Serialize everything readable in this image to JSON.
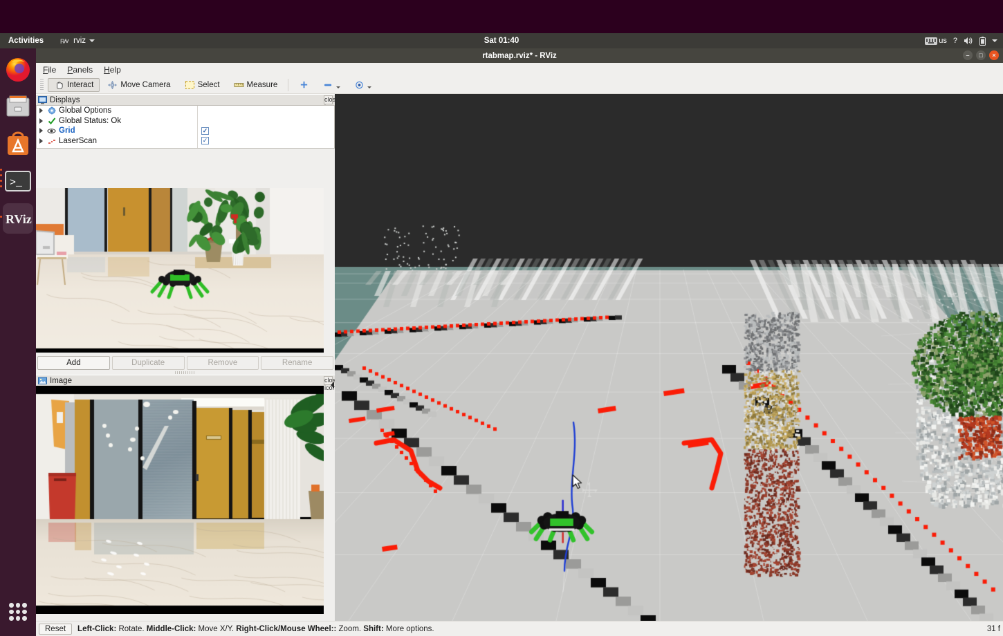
{
  "desktop": {
    "activities_label": "Activities",
    "app_menu_label": "rviz",
    "app_menu_icon": "rviz-icon",
    "clock": "Sat 01:40",
    "tray": {
      "keyboard_layout": "us",
      "help_icon": "?",
      "volume_icon": "speaker-icon",
      "battery_icon": "battery-icon",
      "menu_arrow_icon": "chevron-down-icon"
    },
    "dock_items": [
      {
        "name": "firefox",
        "label": "Firefox",
        "running": false
      },
      {
        "name": "files",
        "label": "Files",
        "running": false
      },
      {
        "name": "ubuntu-software",
        "label": "Ubuntu Software",
        "running": false
      },
      {
        "name": "terminal",
        "label": "Terminal",
        "running": true
      },
      {
        "name": "rviz",
        "label": "RViz",
        "running": true
      }
    ],
    "show_apps_label": "Show Applications"
  },
  "window": {
    "title": "rtabmap.rviz* - RViz",
    "controls": {
      "minimize": "–",
      "maximize": "□",
      "close": "×"
    }
  },
  "menubar": [
    {
      "name": "menu-file",
      "label": "File",
      "mnemonic": "F"
    },
    {
      "name": "menu-panels",
      "label": "Panels",
      "mnemonic": "P"
    },
    {
      "name": "menu-help",
      "label": "Help",
      "mnemonic": "H"
    }
  ],
  "toolbar": {
    "tools": [
      {
        "name": "tool-interact",
        "label": "Interact",
        "icon": "hand-cursor-icon",
        "active": true
      },
      {
        "name": "tool-move-camera",
        "label": "Move Camera",
        "icon": "move-camera-icon",
        "active": false
      },
      {
        "name": "tool-select",
        "label": "Select",
        "icon": "selection-box-icon",
        "active": false
      },
      {
        "name": "tool-measure",
        "label": "Measure",
        "icon": "ruler-icon",
        "active": false
      }
    ],
    "extra": [
      {
        "name": "tool-2d-pose-estimate",
        "icon": "plus-marker-icon",
        "label": ""
      },
      {
        "name": "tool-2d-nav-goal",
        "icon": "arrow-marker-icon",
        "label": "",
        "has_dropdown": true
      },
      {
        "name": "tool-publish-point",
        "icon": "focus-eye-icon",
        "label": "",
        "has_dropdown": true
      }
    ]
  },
  "displays_panel": {
    "title": "Displays",
    "title_icon": "display-monitor-icon",
    "close_icon": "close-icon",
    "tree": [
      {
        "name": "global-options",
        "label": "Global Options",
        "icon": "gear-icon",
        "checkbox": null,
        "expanded": false,
        "selected": false
      },
      {
        "name": "global-status",
        "label": "Global Status: Ok",
        "icon": "check-icon",
        "checkbox": null,
        "expanded": false,
        "selected": false
      },
      {
        "name": "grid",
        "label": "Grid",
        "icon": "grid-eye-icon",
        "checkbox": true,
        "expanded": false,
        "selected": true
      },
      {
        "name": "laserscan",
        "label": "LaserScan",
        "icon": "laserscan-icon",
        "checkbox": true,
        "expanded": false,
        "selected": false
      }
    ],
    "buttons": [
      {
        "name": "add-display-button",
        "label": "Add",
        "enabled": true
      },
      {
        "name": "duplicate-display-button",
        "label": "Duplicate",
        "enabled": false
      },
      {
        "name": "remove-display-button",
        "label": "Remove",
        "enabled": false
      },
      {
        "name": "rename-display-button",
        "label": "Rename",
        "enabled": false
      }
    ]
  },
  "image_panel": {
    "title": "Image",
    "title_icon": "image-icon",
    "close_icon": "close-icon"
  },
  "statusbar": {
    "reset_label": "Reset",
    "hint_parts": [
      {
        "bold": "Left-Click:",
        "text": " Rotate. "
      },
      {
        "bold": "Middle-Click:",
        "text": " Move X/Y. "
      },
      {
        "bold": "Right-Click/Mouse Wheel::",
        "text": " Zoom. "
      },
      {
        "bold": "Shift:",
        "text": " More options."
      }
    ],
    "fps": "31 f"
  },
  "viewport": {
    "background_color": "#2b2b2b",
    "ground_color": "#6b8c87",
    "floor_color": "#c9c9c7",
    "laserscan_color": "#fb1c06",
    "path_color": "#1f3fd4",
    "robot_color": "#31c22a",
    "cursor_icon": "move-cursor-icon",
    "scene_description": "RTAB-Map 3D point cloud of an office lobby with hexapod robot, potted plants and walls"
  }
}
